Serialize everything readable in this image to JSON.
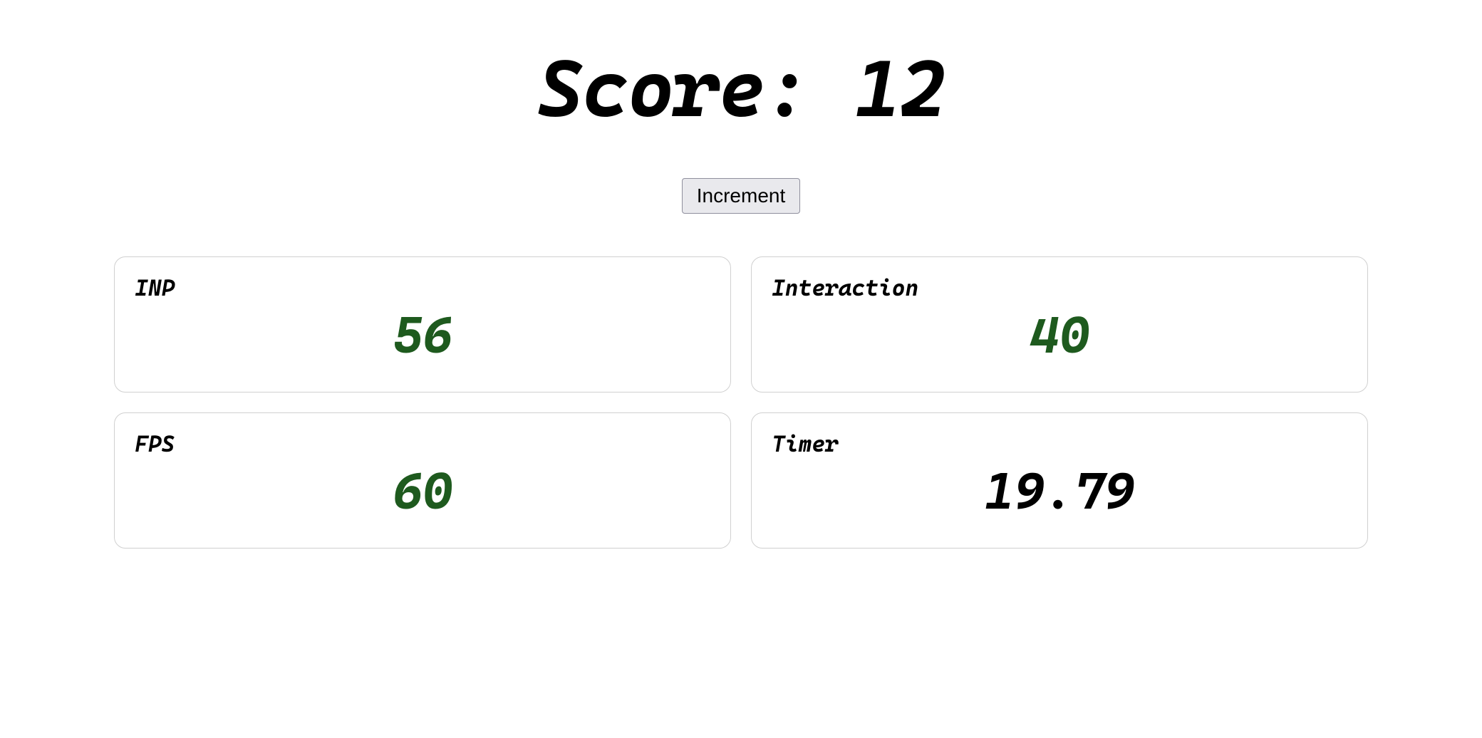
{
  "header": {
    "score_label": "Score:",
    "score_value": "12"
  },
  "controls": {
    "increment_label": "Increment"
  },
  "metrics": {
    "inp": {
      "label": "INP",
      "value": "56"
    },
    "interaction": {
      "label": "Interaction",
      "value": "40"
    },
    "fps": {
      "label": "FPS",
      "value": "60"
    },
    "timer": {
      "label": "Timer",
      "value": "19.79"
    }
  }
}
